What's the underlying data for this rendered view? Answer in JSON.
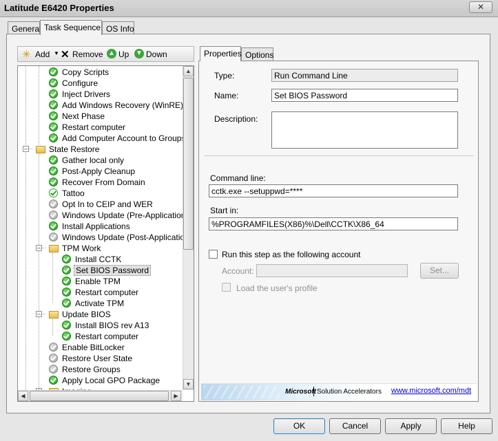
{
  "window": {
    "title": "Latitude E6420 Properties",
    "close_glyph": "✕"
  },
  "tabs": [
    {
      "label": "General"
    },
    {
      "label": "Task Sequence"
    },
    {
      "label": "OS Info"
    }
  ],
  "toolbar": {
    "add": "Add",
    "remove": "Remove",
    "up": "Up",
    "down": "Down"
  },
  "tree": {
    "items": [
      {
        "label": "Copy Scripts",
        "icon": "check-icon",
        "selected": false
      },
      {
        "label": "Configure",
        "icon": "check-icon",
        "selected": false
      },
      {
        "label": "Inject Drivers",
        "icon": "check-icon",
        "selected": false
      },
      {
        "label": "Add Windows Recovery (WinRE)",
        "icon": "check-icon",
        "selected": false
      },
      {
        "label": "Next Phase",
        "icon": "check-icon",
        "selected": false
      },
      {
        "label": "Restart computer",
        "icon": "check-icon",
        "selected": false
      },
      {
        "label": "Add Computer Account to Groups",
        "icon": "check-icon",
        "selected": false
      },
      {
        "label": "State Restore",
        "icon": "folder-icon",
        "selected": false
      },
      {
        "label": "Gather local only",
        "icon": "check-icon",
        "selected": false
      },
      {
        "label": "Post-Apply Cleanup",
        "icon": "check-icon",
        "selected": false
      },
      {
        "label": "Recover From Domain",
        "icon": "check-icon",
        "selected": false
      },
      {
        "label": "Tattoo",
        "icon": "hollow-check-icon",
        "selected": false
      },
      {
        "label": "Opt In to CEIP and WER",
        "icon": "disabled-check-icon",
        "selected": false
      },
      {
        "label": "Windows Update (Pre-Application Inst",
        "icon": "disabled-check-icon",
        "selected": false
      },
      {
        "label": "Install Applications",
        "icon": "check-icon",
        "selected": false
      },
      {
        "label": "Windows Update (Post-Application Ins",
        "icon": "disabled-check-icon",
        "selected": false
      },
      {
        "label": "TPM Work",
        "icon": "folder-icon",
        "selected": false
      },
      {
        "label": "Install CCTK",
        "icon": "check-icon",
        "selected": false
      },
      {
        "label": "Set BIOS Password",
        "icon": "check-icon",
        "selected": true
      },
      {
        "label": "Enable TPM",
        "icon": "check-icon",
        "selected": false
      },
      {
        "label": "Restart computer",
        "icon": "check-icon",
        "selected": false
      },
      {
        "label": "Activate TPM",
        "icon": "check-icon",
        "selected": false
      },
      {
        "label": "Update BIOS",
        "icon": "folder-icon",
        "selected": false
      },
      {
        "label": "Install BIOS rev A13",
        "icon": "check-icon",
        "selected": false
      },
      {
        "label": "Restart computer",
        "icon": "check-icon",
        "selected": false
      },
      {
        "label": "Enable BitLocker",
        "icon": "disabled-check-icon",
        "selected": false
      },
      {
        "label": "Restore User State",
        "icon": "disabled-check-icon",
        "selected": false
      },
      {
        "label": "Restore Groups",
        "icon": "disabled-check-icon",
        "selected": false
      },
      {
        "label": "Apply Local GPO Package",
        "icon": "check-icon",
        "selected": false
      },
      {
        "label": "Imaging",
        "icon": "folder-icon",
        "selected": false
      }
    ]
  },
  "details": {
    "tabs": [
      {
        "label": "Properties"
      },
      {
        "label": "Options"
      }
    ],
    "type_label": "Type:",
    "type_value": "Run Command Line",
    "name_label": "Name:",
    "name_value": "Set BIOS Password",
    "description_label": "Description:",
    "description_value": "",
    "command_label": "Command line:",
    "command_value": "cctk.exe --setuppwd=****",
    "startin_label": "Start in:",
    "startin_value": "%PROGRAMFILES(X86)%\\Dell\\CCTK\\X86_64",
    "runas_label": "Run this step as the following account",
    "account_label": "Account:",
    "account_value": "",
    "set_button": "Set...",
    "load_profile_label": "Load the user's profile"
  },
  "banner": {
    "brand": "Microsoft",
    "product": "Solution Accelerators",
    "link": "www.microsoft.com/mdt"
  },
  "buttons": {
    "ok": "OK",
    "cancel": "Cancel",
    "apply": "Apply",
    "help": "Help"
  },
  "scroll_arrows": {
    "up": "▲",
    "down": "▼",
    "left": "◀",
    "right": "▶"
  },
  "colors": {
    "selection": "#e0e0e0",
    "ok_icon": "#1d9a1d",
    "link": "#0000cc"
  }
}
